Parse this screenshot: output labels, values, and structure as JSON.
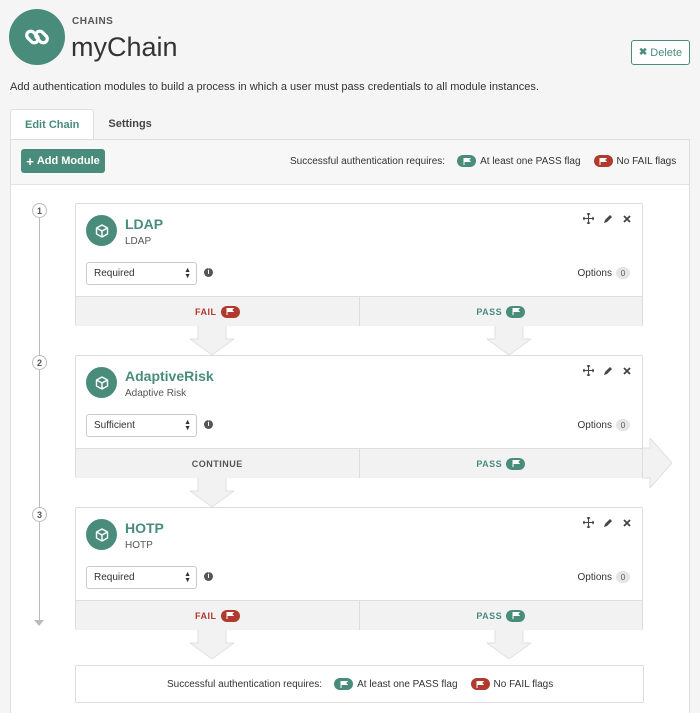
{
  "header": {
    "eyebrow": "CHAINS",
    "title": "myChain",
    "delete_label": "Delete",
    "description": "Add authentication modules to build a process in which a user must pass credentials to all module instances."
  },
  "tabs": [
    {
      "label": "Edit Chain",
      "active": true
    },
    {
      "label": "Settings",
      "active": false
    }
  ],
  "toolbar": {
    "add_module_label": "Add Module",
    "requires_label": "Successful authentication requires:",
    "pass_flag_text": "At least one PASS flag",
    "fail_flag_text": "No FAIL flags"
  },
  "modules": [
    {
      "step": "1",
      "title": "LDAP",
      "subtitle": "LDAP",
      "criteria": "Required",
      "options_label": "Options",
      "options_count": "0",
      "left_label": "FAIL",
      "left_flag": "fail",
      "right_label": "PASS",
      "right_flag": "pass"
    },
    {
      "step": "2",
      "title": "AdaptiveRisk",
      "subtitle": "Adaptive Risk",
      "criteria": "Sufficient",
      "options_label": "Options",
      "options_count": "0",
      "left_label": "CONTINUE",
      "left_flag": "",
      "right_label": "PASS",
      "right_flag": "pass"
    },
    {
      "step": "3",
      "title": "HOTP",
      "subtitle": "HOTP",
      "criteria": "Required",
      "options_label": "Options",
      "options_count": "0",
      "left_label": "FAIL",
      "left_flag": "fail",
      "right_label": "PASS",
      "right_flag": "pass"
    }
  ],
  "footer_summary": {
    "requires_label": "Successful authentication requires:",
    "pass_flag_text": "At least one PASS flag",
    "fail_flag_text": "No FAIL flags"
  },
  "colors": {
    "accent": "#4a8c7c",
    "fail": "#b03a2e"
  },
  "icons": {
    "header": "chain-link-icon",
    "module": "cube-icon",
    "move": "move-icon",
    "edit": "pencil-icon",
    "remove": "close-icon",
    "info": "info-icon",
    "flag": "flag-icon"
  }
}
